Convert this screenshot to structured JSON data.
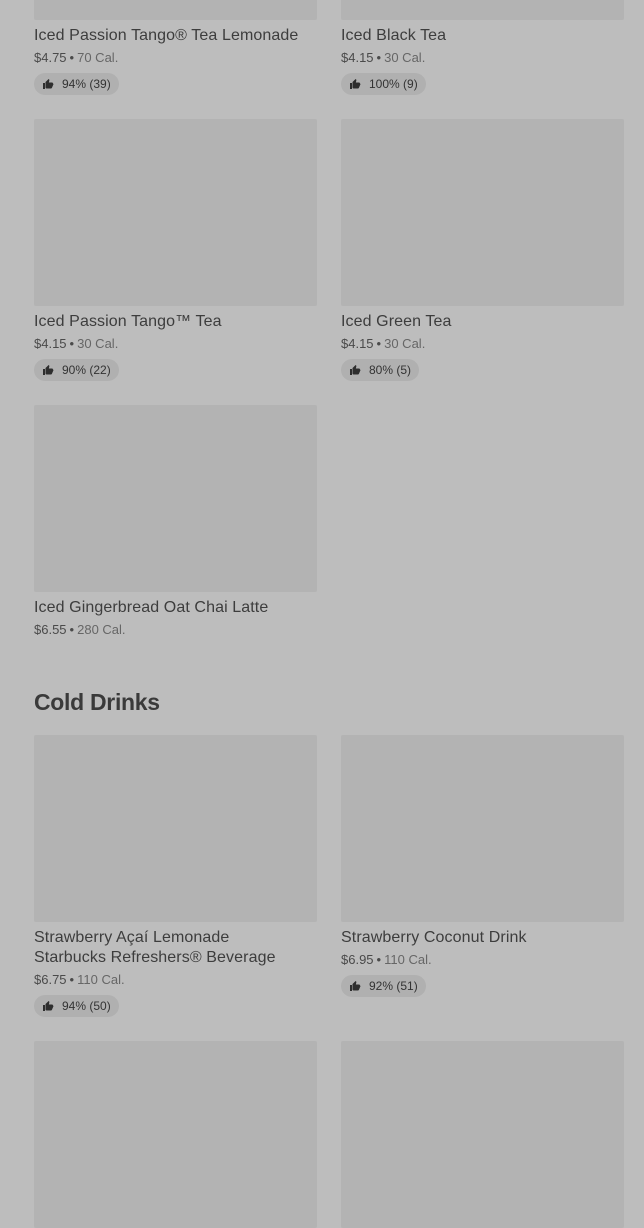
{
  "top_row": [
    {
      "name": "Iced Passion Tango® Tea Lemonade",
      "price": "$4.75",
      "calories": "70 Cal.",
      "rating": "94% (39)"
    },
    {
      "name": "Iced Black Tea",
      "price": "$4.15",
      "calories": "30 Cal.",
      "rating": "100% (9)"
    }
  ],
  "second_row": [
    {
      "name": "Iced Passion Tango™ Tea",
      "price": "$4.15",
      "calories": "30 Cal.",
      "rating": "90% (22)"
    },
    {
      "name": "Iced Green Tea",
      "price": "$4.15",
      "calories": "30 Cal.",
      "rating": "80% (5)"
    }
  ],
  "third_row": [
    {
      "name": "Iced Gingerbread Oat Chai Latte",
      "price": "$6.55",
      "calories": "280 Cal."
    }
  ],
  "section": {
    "title": "Cold Drinks"
  },
  "cold_drinks": [
    {
      "name_line1": "Strawberry Açaí Lemonade",
      "name_line2": "Starbucks Refreshers® Beverage",
      "price": "$6.75",
      "calories": "110 Cal.",
      "rating": "94% (50)"
    },
    {
      "name": "Strawberry Coconut Drink",
      "price": "$6.95",
      "calories": "110 Cal.",
      "rating": "92% (51)"
    }
  ],
  "separator": "•",
  "icons": {
    "rating": "thumbs-up-icon"
  }
}
